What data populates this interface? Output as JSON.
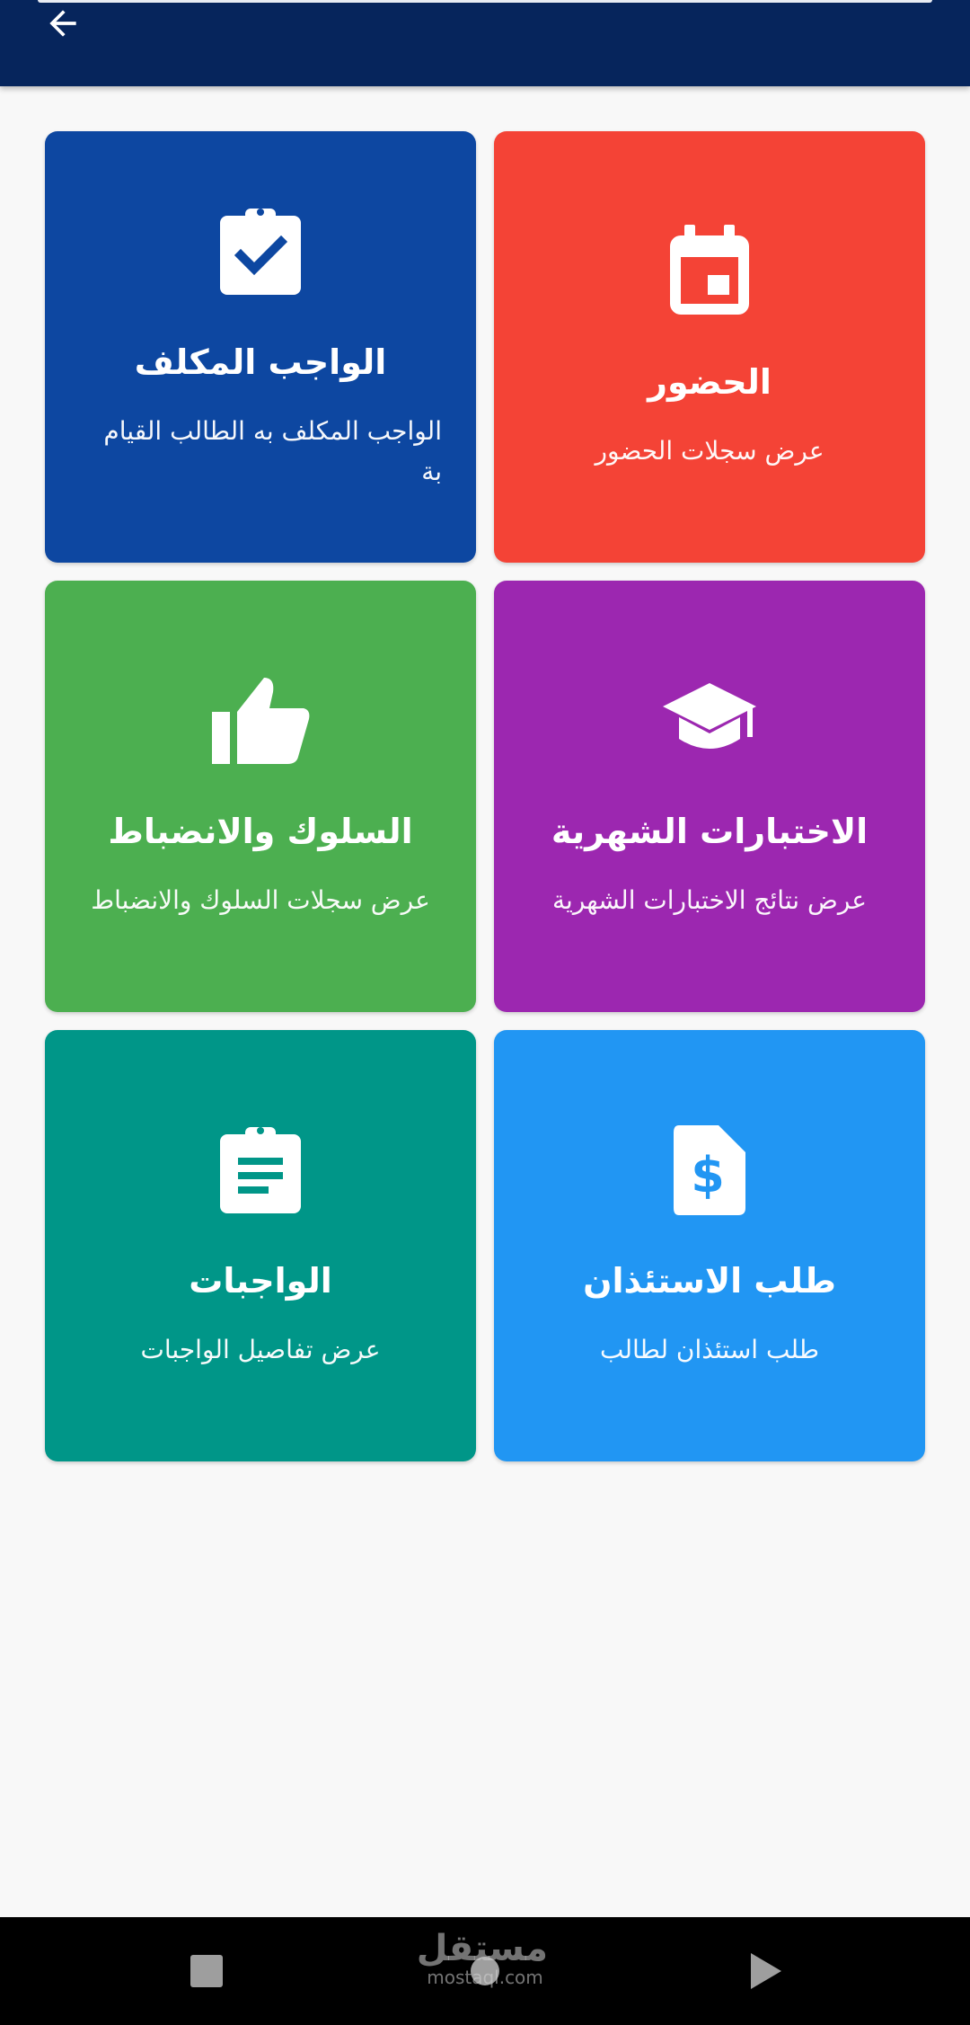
{
  "header": {
    "back_icon": "arrow-back-icon",
    "color": "#06255c"
  },
  "cards": [
    {
      "title": "الحضور",
      "subtitle": "عرض سجلات الحضور",
      "icon": "calendar-icon",
      "color": "#f44336"
    },
    {
      "title": "الواجب المكلف",
      "subtitle": "الواجب المكلف به الطالب القيام بة",
      "icon": "clipboard-check-icon",
      "color": "#0d47a1"
    },
    {
      "title": "الاختبارات الشهرية",
      "subtitle": "عرض نتائج الاختبارات الشهرية",
      "icon": "graduation-cap-icon",
      "color": "#9c27b0"
    },
    {
      "title": "السلوك والانضباط",
      "subtitle": "عرض سجلات السلوك والانضباط",
      "icon": "thumbs-up-icon",
      "color": "#4caf50"
    },
    {
      "title": "طلب الاستئذان",
      "subtitle": "طلب استئذان لطالب",
      "icon": "dollar-document-icon",
      "color": "#2196f3"
    },
    {
      "title": "الواجبات",
      "subtitle": "عرض تفاصيل الواجبات",
      "icon": "clipboard-text-icon",
      "color": "#009688"
    }
  ],
  "navbar": {
    "watermark_ar": "مستقل",
    "watermark_en": "mostaql.com"
  }
}
